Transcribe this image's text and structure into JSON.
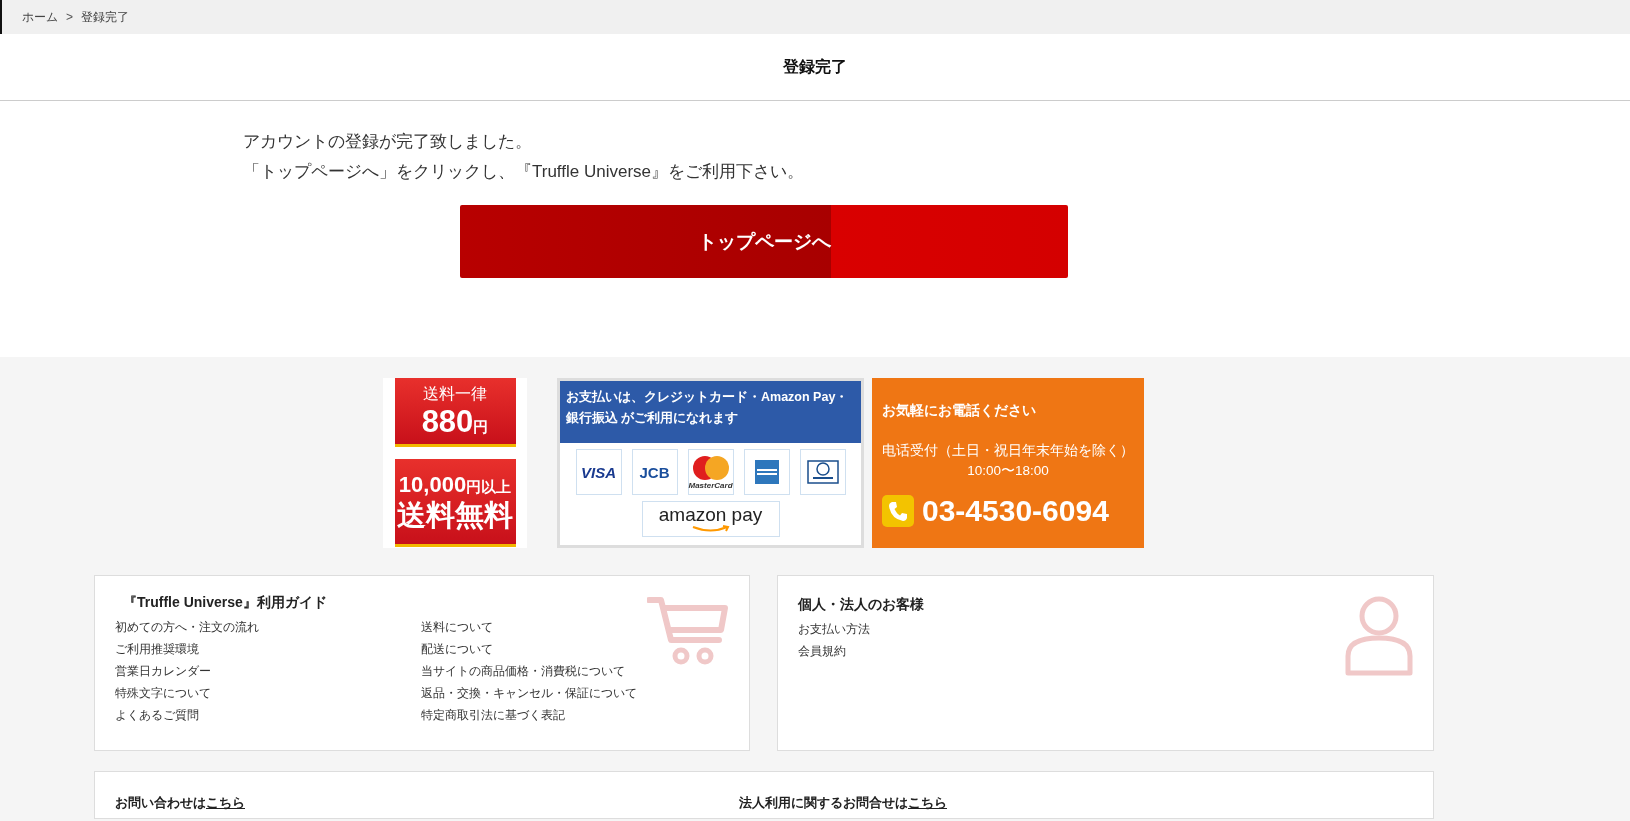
{
  "breadcrumb": {
    "items": [
      "ホーム",
      "登録完了"
    ],
    "separator": ">"
  },
  "page_title": "登録完了",
  "message": [
    "アカウントの登録が完了致しました。",
    "「トップページへ」をクリックし、『Truffle Universe』をご利用下さい。"
  ],
  "primary_button": "トップページへ",
  "banners": {
    "shipping": {
      "label": "送料一律",
      "price": "880",
      "unit": "円"
    },
    "free_shipping": {
      "amount": "10,000",
      "suffix": "円以上",
      "label": "送料無料"
    },
    "payment": {
      "title": [
        "お支払いは、クレジットカード・Amazon Pay・",
        "銀行振込 がご利用になれます"
      ],
      "logos": [
        {
          "kind": "visa",
          "text": "VISA"
        },
        {
          "kind": "jcb",
          "text": "JCB"
        },
        {
          "kind": "mastercard",
          "text": "MasterCard"
        },
        {
          "kind": "amex"
        },
        {
          "kind": "diners"
        },
        {
          "kind": "amazonpay",
          "text": "amazon pay"
        }
      ]
    },
    "phone": {
      "title": "お気軽にお電話ください",
      "hours_label": "电话受付（土日・祝日年末年始を除く）",
      "hours": "10:00〜18:00",
      "number": "03-4530-6094"
    }
  },
  "guide": {
    "title": "『Truffle Universe』利用ガイド",
    "columns": [
      [
        "初めての方へ・注文の流れ",
        "ご利用推奨環境",
        "営業日カレンダー",
        "特殊文字について",
        "よくあるご質問"
      ],
      [
        "送料について",
        "配送について",
        "当サイトの商品価格・消費税について",
        "返品・交換・キャンセル・保証について",
        "特定商取引法に基づく表記"
      ]
    ]
  },
  "customer": {
    "title": "個人・法人のお客様",
    "links": [
      "お支払い方法",
      "会員規約"
    ]
  },
  "contact": [
    {
      "text": "お問い合わせは",
      "link": "こちら"
    },
    {
      "text": "法人利用に関するお問合せは",
      "link": "こちら"
    }
  ]
}
